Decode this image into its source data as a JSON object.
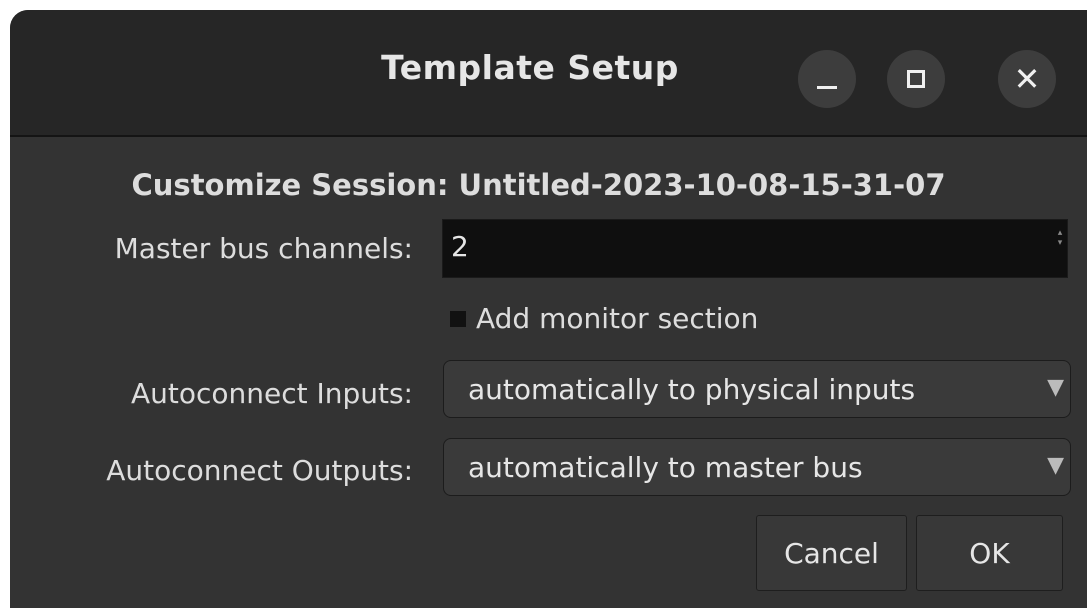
{
  "window": {
    "title": "Template Setup"
  },
  "dialog": {
    "heading": "Customize Session: Untitled-2023-10-08-15-31-07",
    "master_bus": {
      "label": "Master bus channels:",
      "value": "2"
    },
    "monitor_section": {
      "label": "Add monitor section",
      "checked": false
    },
    "autoconnect_inputs": {
      "label": "Autoconnect Inputs:",
      "selected": "automatically to physical inputs"
    },
    "autoconnect_outputs": {
      "label": "Autoconnect Outputs:",
      "selected": "automatically to master bus"
    },
    "buttons": {
      "cancel": "Cancel",
      "ok": "OK"
    }
  },
  "icons": {
    "minimize": "minimize-icon",
    "maximize": "maximize-icon",
    "close": "close-icon",
    "dropdown": "chevron-down-icon"
  },
  "colors": {
    "window_bg": "#333333",
    "titlebar_bg": "#262626",
    "input_bg": "#0f0f0f",
    "text": "#dddddd"
  }
}
